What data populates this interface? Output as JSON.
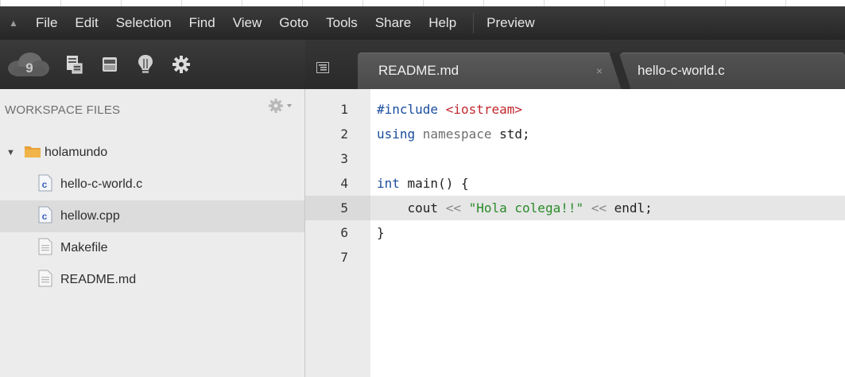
{
  "menu": {
    "items": [
      "File",
      "Edit",
      "Selection",
      "Find",
      "View",
      "Goto",
      "Tools",
      "Share",
      "Help"
    ],
    "preview": "Preview"
  },
  "toolbar": {
    "icons": [
      "cloud9-icon",
      "file-icon",
      "storage-icon",
      "bulb-icon",
      "gear-icon"
    ]
  },
  "tabs": [
    {
      "title": "README.md",
      "close": "×"
    },
    {
      "title": "hello-c-world.c"
    }
  ],
  "sidebar": {
    "header": "WORKSPACE FILES",
    "tree": [
      {
        "name": "holamundo",
        "type": "folder",
        "expanded": true
      },
      {
        "name": "hello-c-world.c",
        "type": "c-file"
      },
      {
        "name": "hellow.cpp",
        "type": "c-file",
        "selected": true
      },
      {
        "name": "Makefile",
        "type": "text-file"
      },
      {
        "name": "README.md",
        "type": "text-file"
      }
    ]
  },
  "editor": {
    "active_line": 5,
    "lines": [
      {
        "n": "1",
        "tokens": [
          [
            "kw",
            "#include "
          ],
          [
            "inc",
            "<iostream>"
          ]
        ]
      },
      {
        "n": "2",
        "tokens": [
          [
            "kw",
            "using "
          ],
          [
            "ns",
            "namespace "
          ],
          [
            "plain",
            "std;"
          ]
        ]
      },
      {
        "n": "3",
        "tokens": []
      },
      {
        "n": "4",
        "tokens": [
          [
            "kw",
            "int "
          ],
          [
            "plain",
            "main() {"
          ]
        ]
      },
      {
        "n": "5",
        "tokens": [
          [
            "plain",
            "    cout "
          ],
          [
            "op",
            "<< "
          ],
          [
            "str",
            "\"Hola colega!!\""
          ],
          [
            "op",
            " << "
          ],
          [
            "plain",
            "endl;"
          ]
        ]
      },
      {
        "n": "6",
        "tokens": [
          [
            "plain",
            "}"
          ]
        ]
      },
      {
        "n": "7",
        "tokens": []
      }
    ]
  },
  "colors": {
    "menubar": "#2f2f2f",
    "sidebar_bg": "#ececec",
    "gutter_bg": "#ebebeb",
    "keyword": "#1a4d9c",
    "include": "#c0272d",
    "string": "#2a8a2a",
    "folder": "#e8a23a"
  }
}
